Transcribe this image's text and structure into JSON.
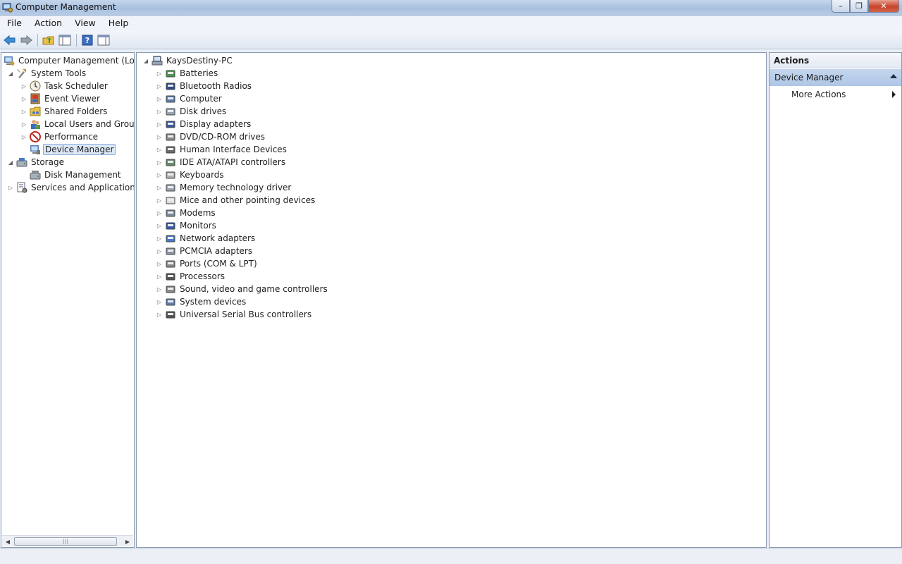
{
  "window": {
    "title": "Computer Management",
    "icon": "computer-management-icon",
    "controls": {
      "minimize": "–",
      "maximize": "❐",
      "close": "✕"
    }
  },
  "menu": [
    "File",
    "Action",
    "View",
    "Help"
  ],
  "toolbar": {
    "buttons": [
      "back-arrow-icon",
      "forward-arrow-icon",
      "up-folder-icon",
      "show-hide-tree-icon",
      "help-icon",
      "show-hide-action-pane-icon"
    ]
  },
  "left_tree": {
    "root": "Computer Management (Local",
    "system_tools": "System Tools",
    "task_scheduler": "Task Scheduler",
    "event_viewer": "Event Viewer",
    "shared_folders": "Shared Folders",
    "local_users": "Local Users and Groups",
    "performance": "Performance",
    "device_manager": "Device Manager",
    "storage": "Storage",
    "disk_management": "Disk Management",
    "services": "Services and Applications",
    "scroll_grip": "|||"
  },
  "device_tree": {
    "computer_name": "KaysDestiny-PC",
    "categories": [
      "Batteries",
      "Bluetooth Radios",
      "Computer",
      "Disk drives",
      "Display adapters",
      "DVD/CD-ROM drives",
      "Human Interface Devices",
      "IDE ATA/ATAPI controllers",
      "Keyboards",
      "Memory technology driver",
      "Mice and other pointing devices",
      "Modems",
      "Monitors",
      "Network adapters",
      "PCMCIA adapters",
      "Ports (COM & LPT)",
      "Processors",
      "Sound, video and game controllers",
      "System devices",
      "Universal Serial Bus controllers"
    ]
  },
  "actions": {
    "header": "Actions",
    "section": "Device Manager",
    "items": [
      "More Actions"
    ]
  },
  "colors": {
    "accent": "#84acdd",
    "section_bg": "#b9cfeb",
    "titlebar": "#b0c6e3"
  }
}
